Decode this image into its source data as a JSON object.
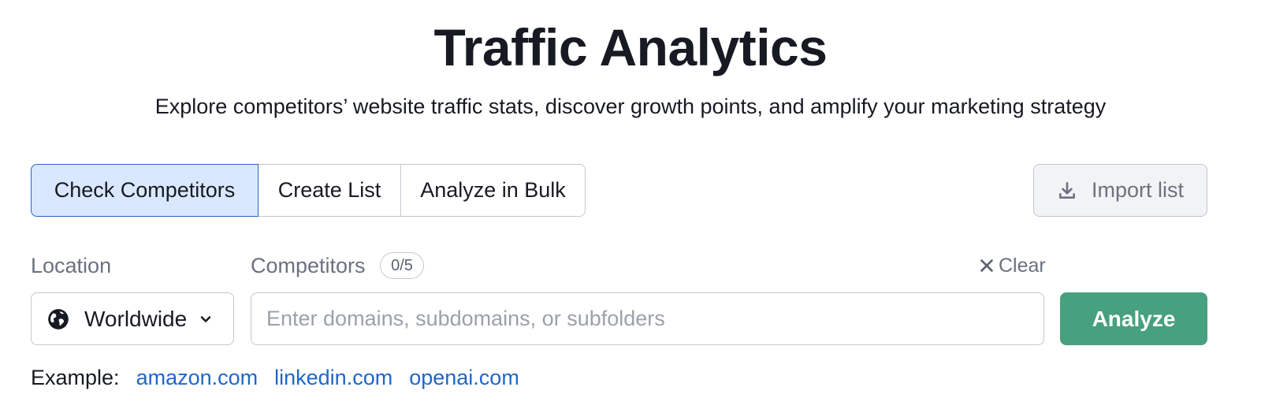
{
  "header": {
    "title": "Traffic Analytics",
    "subtitle": "Explore competitors’ website traffic stats, discover growth points, and amplify your marketing strategy"
  },
  "tabs": [
    {
      "label": "Check Competitors",
      "active": true
    },
    {
      "label": "Create List",
      "active": false
    },
    {
      "label": "Analyze in Bulk",
      "active": false
    }
  ],
  "import": {
    "label": "Import list",
    "icon": "download-icon"
  },
  "location": {
    "label": "Location",
    "value": "Worldwide",
    "icon": "globe-icon"
  },
  "competitors": {
    "label": "Competitors",
    "count": "0/5",
    "clear_label": "Clear",
    "placeholder": "Enter domains, subdomains, or subfolders",
    "value": ""
  },
  "analyze": {
    "label": "Analyze"
  },
  "examples": {
    "label": "Example:",
    "links": [
      "amazon.com",
      "linkedin.com",
      "openai.com"
    ]
  },
  "colors": {
    "accent": "#47a07e",
    "active_tab_bg": "#d9e8ff",
    "active_tab_border": "#2c63c4",
    "link": "#1f66c8"
  }
}
